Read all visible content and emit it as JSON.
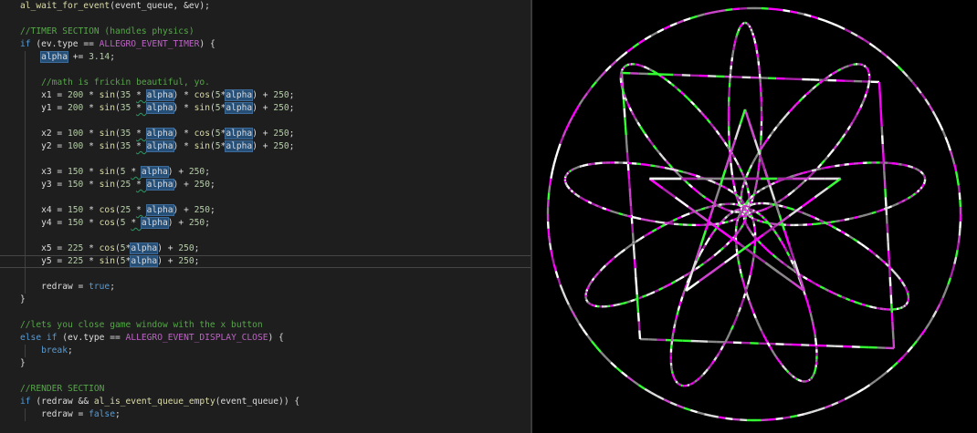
{
  "editor": {
    "lines": [
      [
        {
          "t": "al_wait_for_event",
          "c": "func"
        },
        {
          "t": "(event_queue, &ev);",
          "c": "text"
        }
      ],
      [],
      [
        {
          "t": "//TIMER SECTION (handles physics)",
          "c": "comment"
        }
      ],
      [
        {
          "t": "if",
          "c": "keyword"
        },
        {
          "t": " (ev.type == ",
          "c": "text"
        },
        {
          "t": "ALLEGRO_EVENT_TIMER",
          "c": "macro"
        },
        {
          "t": ") {",
          "c": "text"
        }
      ],
      [
        {
          "t": "    ",
          "c": "text"
        },
        {
          "t": "alpha",
          "c": "hl"
        },
        {
          "t": " += ",
          "c": "text"
        },
        {
          "t": "3.14",
          "c": "number"
        },
        {
          "t": ";",
          "c": "text"
        }
      ],
      [],
      [
        {
          "t": "    ",
          "c": "text"
        },
        {
          "t": "//math is frickin beautiful, yo.",
          "c": "comment"
        }
      ],
      [
        {
          "t": "    x1 = ",
          "c": "text"
        },
        {
          "t": "200",
          "c": "number"
        },
        {
          "t": " * ",
          "c": "text"
        },
        {
          "t": "sin",
          "c": "func"
        },
        {
          "t": "(",
          "c": "text"
        },
        {
          "t": "35",
          "c": "number"
        },
        {
          "t": " ",
          "c": "text"
        },
        {
          "t": "* ",
          "c": "squiggle"
        },
        {
          "t": "alpha",
          "c": "hl"
        },
        {
          "t": ") * ",
          "c": "text"
        },
        {
          "t": "cos",
          "c": "func"
        },
        {
          "t": "(",
          "c": "text"
        },
        {
          "t": "5",
          "c": "number"
        },
        {
          "t": "*",
          "c": "text"
        },
        {
          "t": "alpha",
          "c": "hl"
        },
        {
          "t": ") + ",
          "c": "text"
        },
        {
          "t": "250",
          "c": "number"
        },
        {
          "t": ";",
          "c": "text"
        }
      ],
      [
        {
          "t": "    y1 = ",
          "c": "text"
        },
        {
          "t": "200",
          "c": "number"
        },
        {
          "t": " * ",
          "c": "text"
        },
        {
          "t": "sin",
          "c": "func"
        },
        {
          "t": "(",
          "c": "text"
        },
        {
          "t": "35",
          "c": "number"
        },
        {
          "t": " ",
          "c": "text"
        },
        {
          "t": "* ",
          "c": "squiggle"
        },
        {
          "t": "alpha",
          "c": "hl"
        },
        {
          "t": ") * ",
          "c": "text"
        },
        {
          "t": "sin",
          "c": "func"
        },
        {
          "t": "(",
          "c": "text"
        },
        {
          "t": "5",
          "c": "number"
        },
        {
          "t": "*",
          "c": "text"
        },
        {
          "t": "alpha",
          "c": "hl"
        },
        {
          "t": ") + ",
          "c": "text"
        },
        {
          "t": "250",
          "c": "number"
        },
        {
          "t": ";",
          "c": "text"
        }
      ],
      [],
      [
        {
          "t": "    x2 = ",
          "c": "text"
        },
        {
          "t": "100",
          "c": "number"
        },
        {
          "t": " * ",
          "c": "text"
        },
        {
          "t": "sin",
          "c": "func"
        },
        {
          "t": "(",
          "c": "text"
        },
        {
          "t": "35",
          "c": "number"
        },
        {
          "t": " ",
          "c": "text"
        },
        {
          "t": "* ",
          "c": "squiggle"
        },
        {
          "t": "alpha",
          "c": "hl"
        },
        {
          "t": ") * ",
          "c": "text"
        },
        {
          "t": "cos",
          "c": "func"
        },
        {
          "t": "(",
          "c": "text"
        },
        {
          "t": "5",
          "c": "number"
        },
        {
          "t": "*",
          "c": "text"
        },
        {
          "t": "alpha",
          "c": "hl"
        },
        {
          "t": ") + ",
          "c": "text"
        },
        {
          "t": "250",
          "c": "number"
        },
        {
          "t": ";",
          "c": "text"
        }
      ],
      [
        {
          "t": "    y2 = ",
          "c": "text"
        },
        {
          "t": "100",
          "c": "number"
        },
        {
          "t": " * ",
          "c": "text"
        },
        {
          "t": "sin",
          "c": "func"
        },
        {
          "t": "(",
          "c": "text"
        },
        {
          "t": "35",
          "c": "number"
        },
        {
          "t": " ",
          "c": "text"
        },
        {
          "t": "* ",
          "c": "squiggle"
        },
        {
          "t": "alpha",
          "c": "hl"
        },
        {
          "t": ") * ",
          "c": "text"
        },
        {
          "t": "sin",
          "c": "func"
        },
        {
          "t": "(",
          "c": "text"
        },
        {
          "t": "5",
          "c": "number"
        },
        {
          "t": "*",
          "c": "text"
        },
        {
          "t": "alpha",
          "c": "hl"
        },
        {
          "t": ") + ",
          "c": "text"
        },
        {
          "t": "250",
          "c": "number"
        },
        {
          "t": ";",
          "c": "text"
        }
      ],
      [],
      [
        {
          "t": "    x3 = ",
          "c": "text"
        },
        {
          "t": "150",
          "c": "number"
        },
        {
          "t": " * ",
          "c": "text"
        },
        {
          "t": "sin",
          "c": "func"
        },
        {
          "t": "(",
          "c": "text"
        },
        {
          "t": "5",
          "c": "number"
        },
        {
          "t": " ",
          "c": "text"
        },
        {
          "t": "* ",
          "c": "squiggle"
        },
        {
          "t": "alpha",
          "c": "hl"
        },
        {
          "t": ") + ",
          "c": "text"
        },
        {
          "t": "250",
          "c": "number"
        },
        {
          "t": ";",
          "c": "text"
        }
      ],
      [
        {
          "t": "    y3 = ",
          "c": "text"
        },
        {
          "t": "150",
          "c": "number"
        },
        {
          "t": " * ",
          "c": "text"
        },
        {
          "t": "sin",
          "c": "func"
        },
        {
          "t": "(",
          "c": "text"
        },
        {
          "t": "25",
          "c": "number"
        },
        {
          "t": " ",
          "c": "text"
        },
        {
          "t": "* ",
          "c": "squiggle"
        },
        {
          "t": "alpha",
          "c": "hl"
        },
        {
          "t": ") + ",
          "c": "text"
        },
        {
          "t": "250",
          "c": "number"
        },
        {
          "t": ";",
          "c": "text"
        }
      ],
      [],
      [
        {
          "t": "    x4 = ",
          "c": "text"
        },
        {
          "t": "150",
          "c": "number"
        },
        {
          "t": " * ",
          "c": "text"
        },
        {
          "t": "cos",
          "c": "func"
        },
        {
          "t": "(",
          "c": "text"
        },
        {
          "t": "25",
          "c": "number"
        },
        {
          "t": " ",
          "c": "text"
        },
        {
          "t": "* ",
          "c": "squiggle"
        },
        {
          "t": "alpha",
          "c": "hl"
        },
        {
          "t": ") + ",
          "c": "text"
        },
        {
          "t": "250",
          "c": "number"
        },
        {
          "t": ";",
          "c": "text"
        }
      ],
      [
        {
          "t": "    y4 = ",
          "c": "text"
        },
        {
          "t": "150",
          "c": "number"
        },
        {
          "t": " * ",
          "c": "text"
        },
        {
          "t": "cos",
          "c": "func"
        },
        {
          "t": "(",
          "c": "text"
        },
        {
          "t": "5",
          "c": "number"
        },
        {
          "t": " ",
          "c": "text"
        },
        {
          "t": "* ",
          "c": "squiggle"
        },
        {
          "t": "alpha",
          "c": "hl"
        },
        {
          "t": ") + ",
          "c": "text"
        },
        {
          "t": "250",
          "c": "number"
        },
        {
          "t": ";",
          "c": "text"
        }
      ],
      [],
      [
        {
          "t": "    x5 = ",
          "c": "text"
        },
        {
          "t": "225",
          "c": "number"
        },
        {
          "t": " * ",
          "c": "text"
        },
        {
          "t": "cos",
          "c": "func"
        },
        {
          "t": "(",
          "c": "text"
        },
        {
          "t": "5",
          "c": "number"
        },
        {
          "t": "*",
          "c": "text"
        },
        {
          "t": "alpha",
          "c": "hl"
        },
        {
          "t": ") + ",
          "c": "text"
        },
        {
          "t": "250",
          "c": "number"
        },
        {
          "t": ";",
          "c": "text"
        }
      ],
      [
        {
          "t": "    y5 = ",
          "c": "text"
        },
        {
          "t": "225",
          "c": "number"
        },
        {
          "t": " * ",
          "c": "text"
        },
        {
          "t": "sin",
          "c": "func"
        },
        {
          "t": "(",
          "c": "text"
        },
        {
          "t": "5",
          "c": "number"
        },
        {
          "t": "*",
          "c": "text"
        },
        {
          "t": "alpha",
          "c": "hl"
        },
        {
          "t": ") + ",
          "c": "text"
        },
        {
          "t": "250",
          "c": "number"
        },
        {
          "t": ";",
          "c": "text"
        }
      ],
      [],
      [
        {
          "t": "    redraw = ",
          "c": "text"
        },
        {
          "t": "true",
          "c": "keyword"
        },
        {
          "t": ";",
          "c": "text"
        }
      ],
      [
        {
          "t": "}",
          "c": "text"
        }
      ],
      [],
      [
        {
          "t": "//lets you close game window with the x button",
          "c": "comment"
        }
      ],
      [
        {
          "t": "else",
          "c": "keyword"
        },
        {
          "t": " ",
          "c": "text"
        },
        {
          "t": "if",
          "c": "keyword"
        },
        {
          "t": " (ev.type == ",
          "c": "text"
        },
        {
          "t": "ALLEGRO_EVENT_DISPLAY_CLOSE",
          "c": "macro"
        },
        {
          "t": ") {",
          "c": "text"
        }
      ],
      [
        {
          "t": "    ",
          "c": "text"
        },
        {
          "t": "break",
          "c": "keyword"
        },
        {
          "t": ";",
          "c": "text"
        }
      ],
      [
        {
          "t": "}",
          "c": "text"
        }
      ],
      [],
      [
        {
          "t": "//RENDER SECTION",
          "c": "comment"
        }
      ],
      [
        {
          "t": "if",
          "c": "keyword"
        },
        {
          "t": " (redraw && ",
          "c": "text"
        },
        {
          "t": "al_is_event_queue_empty",
          "c": "func"
        },
        {
          "t": "(event_queue)) {",
          "c": "text"
        }
      ],
      [
        {
          "t": "    redraw = ",
          "c": "text"
        },
        {
          "t": "false",
          "c": "keyword"
        },
        {
          "t": ";",
          "c": "text"
        }
      ]
    ],
    "current_line_index": 20
  },
  "canvas": {
    "background": "#000000",
    "palette": [
      "#ff00ff",
      "#cc44cc",
      "#dddddd",
      "#33ff33",
      "#888888",
      "#aa22aa",
      "#ffffff"
    ]
  }
}
